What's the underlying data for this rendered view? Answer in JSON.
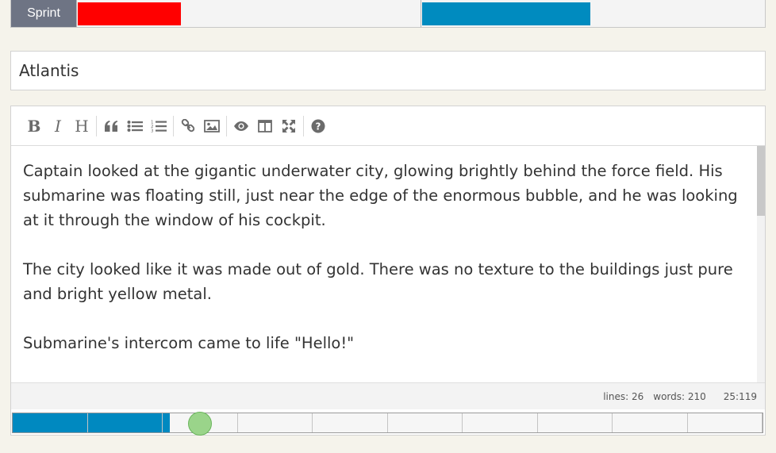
{
  "sprint": {
    "label": "Sprint",
    "bar_1": {
      "progress_percent": 30,
      "color": "#ff0000"
    },
    "bar_2": {
      "progress_percent": 49,
      "color": "#008bbf"
    }
  },
  "title": {
    "value": "Atlantis"
  },
  "toolbar": {
    "groups": [
      [
        "bold-icon",
        "italic-icon",
        "heading-icon"
      ],
      [
        "quote-icon",
        "unordered-list-icon",
        "ordered-list-icon"
      ],
      [
        "link-icon",
        "image-icon"
      ],
      [
        "preview-icon",
        "side-by-side-icon",
        "fullscreen-icon"
      ],
      [
        "help-icon"
      ]
    ]
  },
  "editor": {
    "paragraphs": [
      "Captain looked at the gigantic underwater city, glowing brightly behind the force field. His submarine was floating still, just near the edge of the enormous bubble, and he was looking at it through the window of his cockpit.",
      "The city looked like it was made out of gold. There was no texture to the buildings just pure and bright yellow metal.",
      "Submarine's intercom came to life \"Hello!\""
    ]
  },
  "status": {
    "lines": "lines: 26",
    "words": "words: 210",
    "cursor": "25:119"
  },
  "progress": {
    "segments": 10,
    "filled_fraction": 0.21,
    "marker_fraction": 0.25,
    "fill_color": "#0089c0",
    "marker_color": "#9ad48a"
  }
}
